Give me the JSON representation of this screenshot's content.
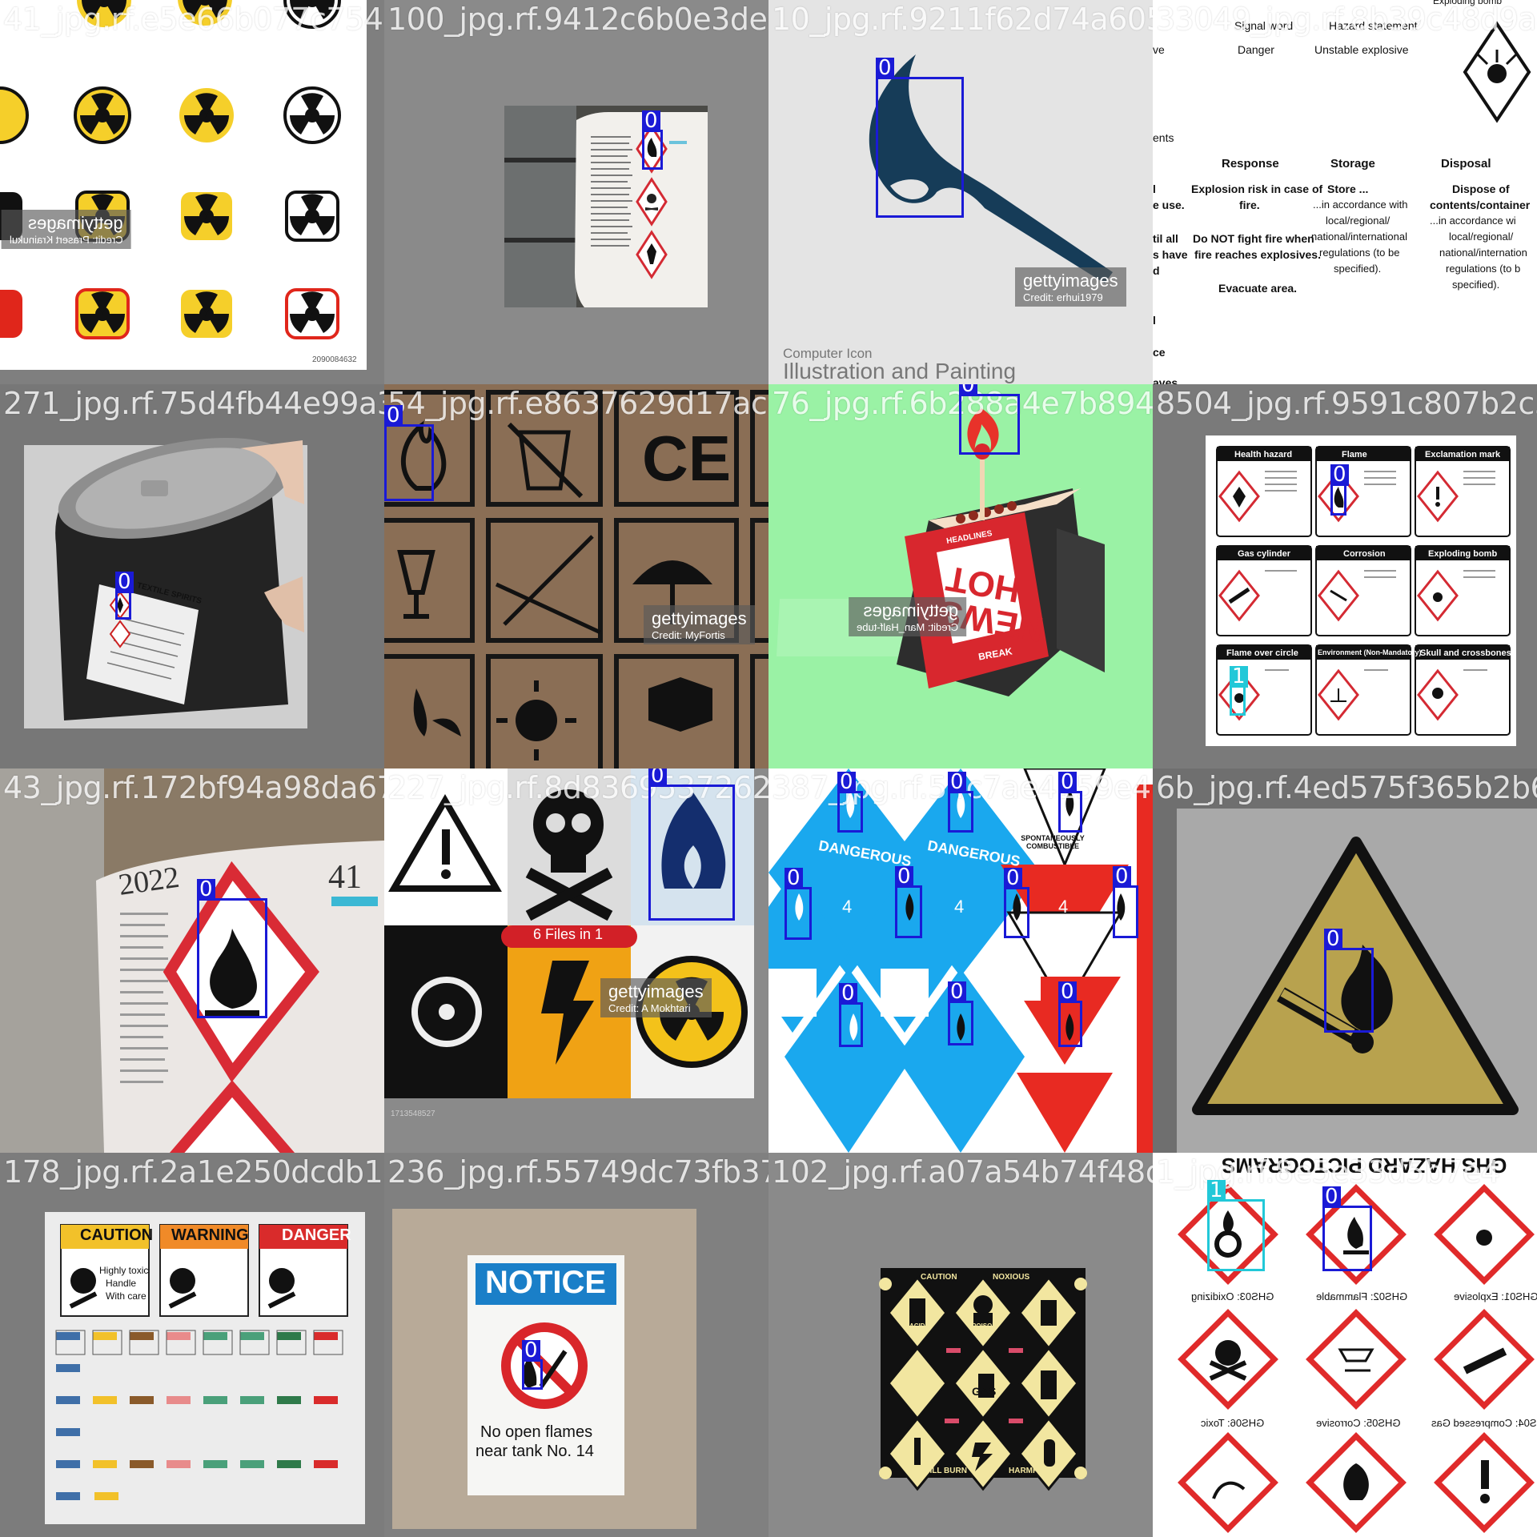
{
  "colors": {
    "class0": "#1a1ad6",
    "class1": "#22c8d8"
  },
  "tiles": [
    {
      "filename": "41_jpg.rf.e5e66b077c7543e32e6a10942706",
      "texts": {
        "wm1": "gettyimages",
        "wm2": "Credit: Prasert Krainukul",
        "id": "2090084632"
      },
      "boxes": []
    },
    {
      "filename": "100_jpg.rf.9412c6b0e3dedff66",
      "texts": {},
      "boxes": [
        {
          "cls": "0"
        }
      ]
    },
    {
      "filename": "10_jpg.rf.9211f62d74a6052b33049",
      "texts": {
        "wm1": "gettyimages",
        "wm2": "Credit: erhui1979",
        "cap1": "Computer  Icon",
        "cap2": "Illustration and Painting"
      },
      "boxes": [
        {
          "cls": "0"
        }
      ]
    },
    {
      "filename": "33049_jpg.rf.8b39c48d9a8602a51",
      "texts": {
        "h1": "Signal word",
        "h2": "Hazard statement",
        "s1": "Danger",
        "s2": "Unstable explosive",
        "side1": "ve",
        "side2": "ents",
        "side3": "l",
        "side4": "e use.",
        "side5": "til all",
        "side6": "s have",
        "side7": "d",
        "side8": "l",
        "side9": "ce",
        "side10": "aves",
        "c1h": "Response",
        "c2h": "Storage",
        "c3h": "Disposal",
        "c1a": "Explosion risk in case of",
        "c1b": "fire.",
        "c1c": "Do NOT fight fire when",
        "c1d": "fire reaches explosives.",
        "c1e": "Evacuate area.",
        "c2a": "Store ...",
        "c2b": "...in accordance with",
        "c2c": "local/regional/",
        "c2d": "national/international",
        "c2e": "regulations (to be",
        "c2f": "specified).",
        "c3a": "Dispose of",
        "c3b": "contents/container",
        "c3c": "...in accordance wi",
        "c3d": "local/regional/",
        "c3e": "national/internation",
        "c3f": "regulations (to b",
        "c3g": "specified).",
        "top": "Exploding bomb"
      },
      "boxes": []
    },
    {
      "filename": "271_jpg.rf.75d4fb44e99a32c",
      "texts": {
        "label": "TEXTILE SPIRITS"
      },
      "boxes": [
        {
          "cls": "0"
        }
      ]
    },
    {
      "filename": "54_jpg.rf.e8637629d17ac67f07",
      "texts": {
        "wm1": "gettyimages",
        "wm2": "Credit: MyFortis"
      },
      "boxes": [
        {
          "cls": "0"
        }
      ]
    },
    {
      "filename": "76_jpg.rf.6b288a4e7b894f0856",
      "texts": {
        "wm1": "gettyimages",
        "wm2": "Credit: Man_Half-tube",
        "b1": "HOT",
        "b2": "NEWS",
        "b3": "HEADLINES",
        "b4": "BREAK"
      },
      "boxes": [
        {
          "cls": "0"
        }
      ]
    },
    {
      "filename": "8504_jpg.rf.9591c807b2c3d37",
      "texts": {
        "p1": "Health hazard",
        "p2": "Flame",
        "p3": "Exclamation mark",
        "p4": "Gas cylinder",
        "p5": "Corrosion",
        "p6": "Exploding bomb",
        "p7": "Flame over circle",
        "p8": "Environment (Non-Mandatory)",
        "p9": "Skull and crossbones"
      },
      "boxes": [
        {
          "cls": "0"
        },
        {
          "cls": "1"
        }
      ]
    },
    {
      "filename": "43_jpg.rf.172bf94a98da6758",
      "texts": {
        "num": "41"
      },
      "boxes": [
        {
          "cls": "0"
        }
      ]
    },
    {
      "filename": "227_jpg.rf.8d8369537262a3be8",
      "texts": {
        "banner": "6 Files in 1",
        "wm1": "gettyimages",
        "wm2": "Credit: A Mokhtari",
        "id": "1713548527"
      },
      "boxes": [
        {
          "cls": "0"
        }
      ]
    },
    {
      "filename": "387_jpg.rf.54c7ae4159e4066",
      "texts": {
        "d1": "DANGEROUS",
        "d2": "DANGEROUS",
        "d3": "SPONTANEOUSLY COMBUSTIBLE"
      },
      "boxes": [
        {
          "cls": "0"
        },
        {
          "cls": "0"
        },
        {
          "cls": "0"
        },
        {
          "cls": "0"
        },
        {
          "cls": "0"
        },
        {
          "cls": "0"
        },
        {
          "cls": "0"
        },
        {
          "cls": "0"
        },
        {
          "cls": "0"
        },
        {
          "cls": "0"
        }
      ]
    },
    {
      "filename": "6b_jpg.rf.4ed575f365b2b6c7",
      "texts": {},
      "boxes": [
        {
          "cls": "0"
        }
      ]
    },
    {
      "filename": "178_jpg.rf.2a1e250dcdb150235",
      "texts": {
        "w1": "CAUTION",
        "w2": "WARNING",
        "w3": "DANGER",
        "x1": "Highly toxic",
        "x2": "Handle",
        "x3": "With care"
      },
      "boxes": []
    },
    {
      "filename": "236_jpg.rf.55749dc73fb37a9fb",
      "texts": {
        "notice": "NOTICE",
        "l1": "No open flames",
        "l2": "near tank No. 14"
      },
      "boxes": [
        {
          "cls": "0"
        }
      ]
    },
    {
      "filename": "102_jpg.rf.a07a54b74f48dc71",
      "texts": {
        "k1": "CAUTION",
        "k2": "NOXIOUS",
        "k3": "GAS",
        "k4": "WILL BURN",
        "k5": "HARMFUL",
        "k6": "ACID",
        "k7": "POISON"
      },
      "boxes": []
    },
    {
      "filename": "1_jpg.rf.8e5e33d5b7e4",
      "texts": {
        "title": "GHS HAZARD PICTOGRAMS",
        "g1": "GHS03: Oxidizing",
        "g2": "GHS02: Flammable",
        "g3": "GHS01: Explosive",
        "g4": "GHS06: Toxic",
        "g5": "GHS05: Corrosive",
        "g6": "GHS04: Compressed Gas"
      },
      "boxes": [
        {
          "cls": "1"
        },
        {
          "cls": "0"
        }
      ]
    }
  ]
}
